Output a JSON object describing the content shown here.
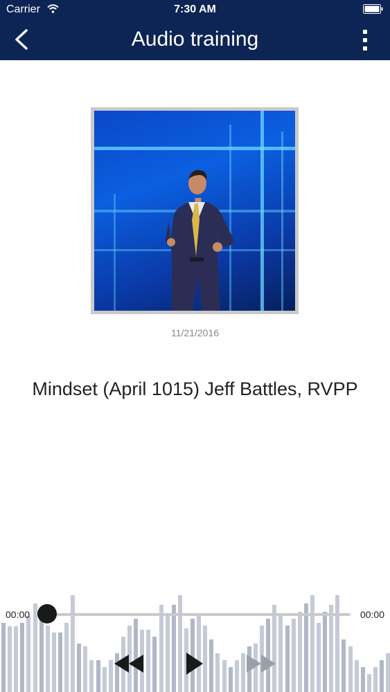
{
  "status_bar": {
    "carrier": "Carrier",
    "time": "7:30 AM"
  },
  "header": {
    "title": "Audio training",
    "back_icon": "chevron-left-icon",
    "menu_icon": "more-vertical-icon"
  },
  "track": {
    "date": "11/21/2016",
    "title": "Mindset (April 1015) Jeff Battles, RVPP"
  },
  "player": {
    "elapsed": "00:00",
    "remaining": "00:00",
    "progress": 0,
    "controls": [
      "rewind-icon",
      "play-icon",
      "fast-forward-icon"
    ]
  },
  "colors": {
    "header_bg": "#0d2554",
    "waveform": "#c6cad6",
    "thumb": "#1a1a1a",
    "disabled_control": "#9aa0aa"
  }
}
